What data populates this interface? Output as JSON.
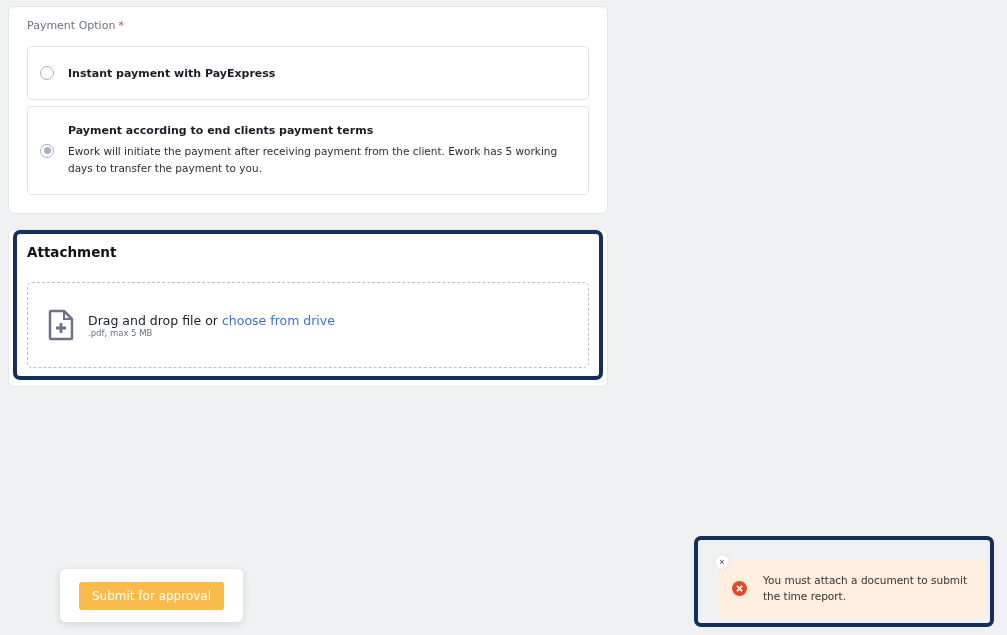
{
  "payment_option": {
    "label": "Payment Option",
    "required_mark": "*",
    "options": [
      {
        "title": "Instant payment with PayExpress",
        "selected": false
      },
      {
        "title": "Payment according to end clients payment terms",
        "description": "Ework will initiate the payment after receiving payment from the client. Ework has 5 working days to transfer the payment to you.",
        "selected": true
      }
    ]
  },
  "attachment": {
    "title": "Attachment",
    "highlighted": true,
    "drop_text": "Drag and drop file or",
    "link": "choose from drive",
    "hint": ".pdf, max 5 MB"
  },
  "submit_button": "Submit for approval",
  "toast": {
    "highlighted": true,
    "close": "×",
    "message": "You must attach a document to submit the time report."
  }
}
